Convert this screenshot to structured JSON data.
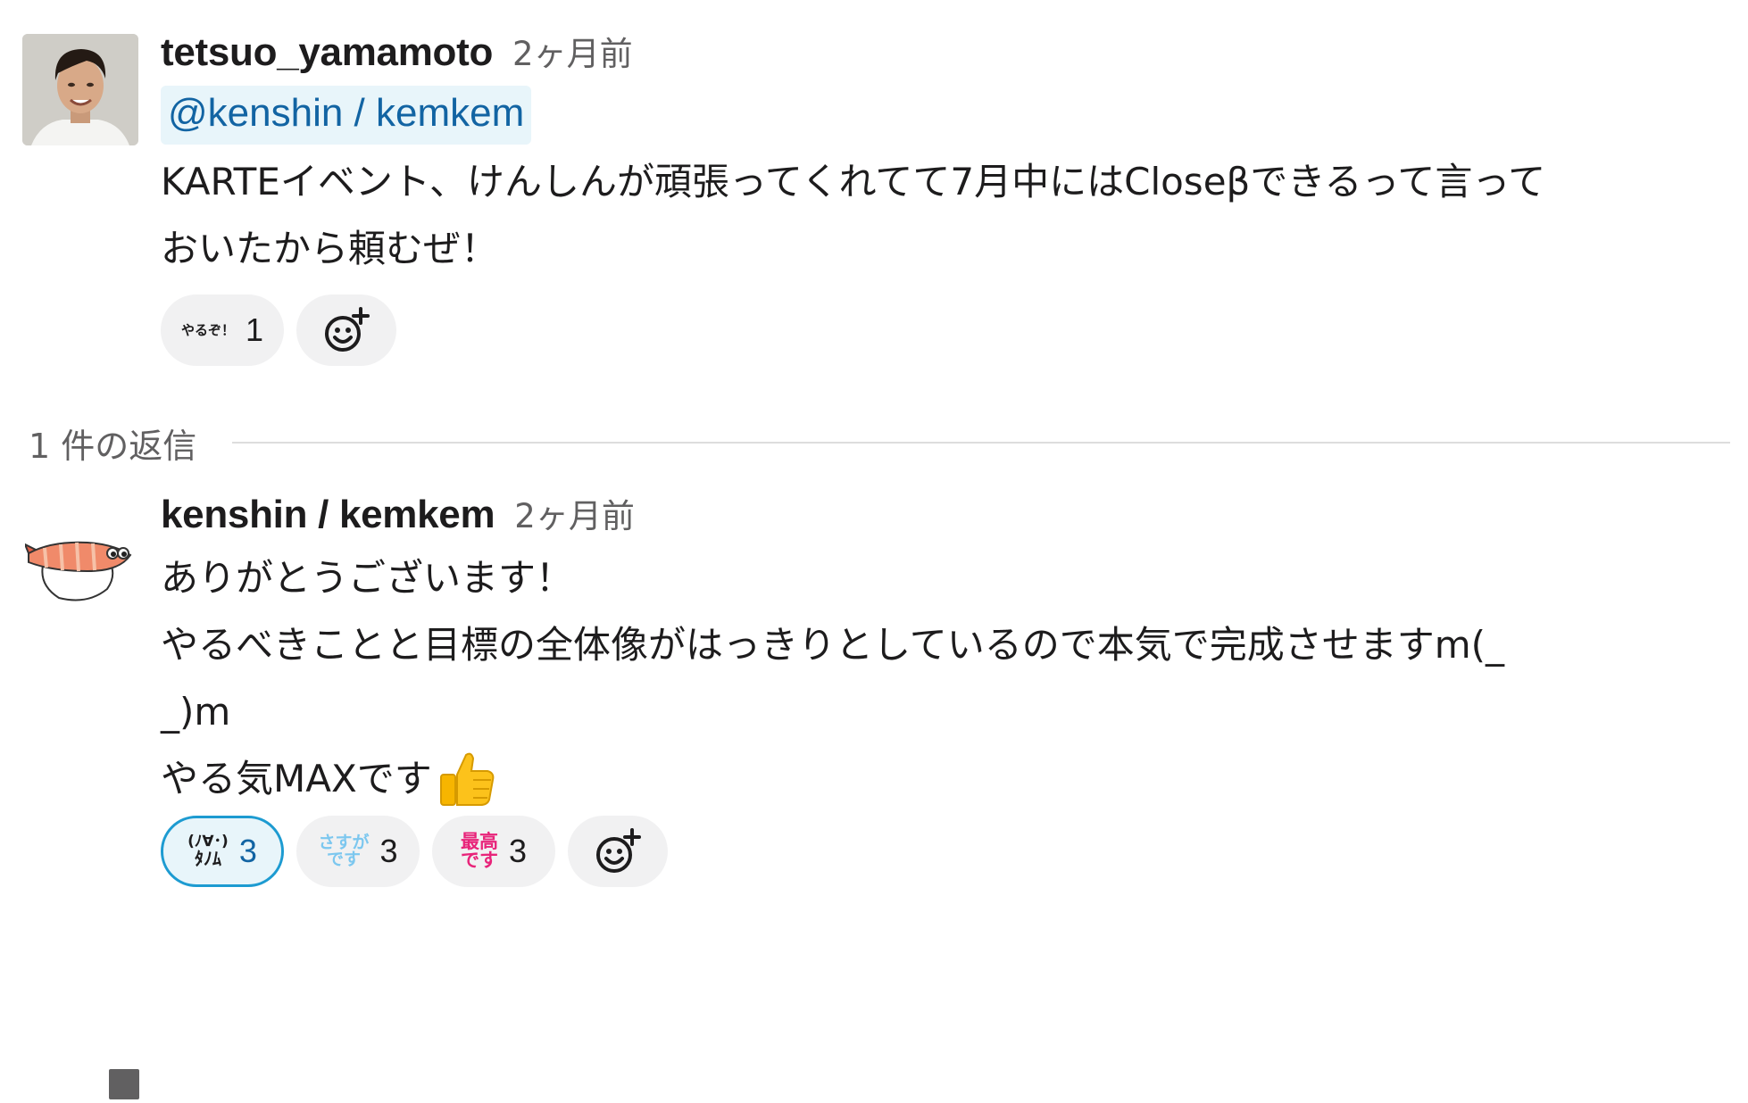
{
  "message_1": {
    "username": "tetsuo_yamamoto",
    "timestamp": "2ヶ月前",
    "mention": "@kenshin / kemkem",
    "lines": [
      "KARTEイベント、けんしんが頑張ってくれてて7月中にはCloseβできるって言って",
      "おいたから頼むぜ！"
    ],
    "reactions": [
      {
        "emoji_text": "やるぞ！",
        "emoji_name": "yaruzo-emoji",
        "count": "1"
      }
    ]
  },
  "thread": {
    "reply_count": "1 件の返信"
  },
  "message_2": {
    "username": "kenshin / kemkem",
    "timestamp": "2ヶ月前",
    "lines": [
      "ありがとうございます！",
      "やるべきことと目標の全体像がはっきりとしているので本気で完成させますm(_",
      "_)m",
      "やる気MAXです"
    ],
    "reactions": [
      {
        "emoji_text_top": "(ﾉ∀･)",
        "emoji_text_bottom": "ﾀﾉﾑ",
        "emoji_name": "tanomu-emoji",
        "count": "3",
        "mine": true,
        "color": "#1d1c1d"
      },
      {
        "emoji_text_top": "さすが",
        "emoji_text_bottom": "です",
        "emoji_name": "sasuga-desu-emoji",
        "count": "3",
        "color": "#7cc7ef"
      },
      {
        "emoji_text_top": "最高",
        "emoji_text_bottom": "です",
        "emoji_name": "saikou-desu-emoji",
        "count": "3",
        "color": "#e8247a"
      }
    ]
  },
  "colors": {
    "mention_bg": "#e8f5fa",
    "mention_text": "#1264a3",
    "reaction_bg": "#f1f1f2",
    "reaction_mine_border": "#1d9bd1",
    "timestamp": "#616061"
  },
  "icons": {
    "add_reaction": "add-reaction-icon",
    "thumbs_up": "thumbs-up-emoji"
  }
}
